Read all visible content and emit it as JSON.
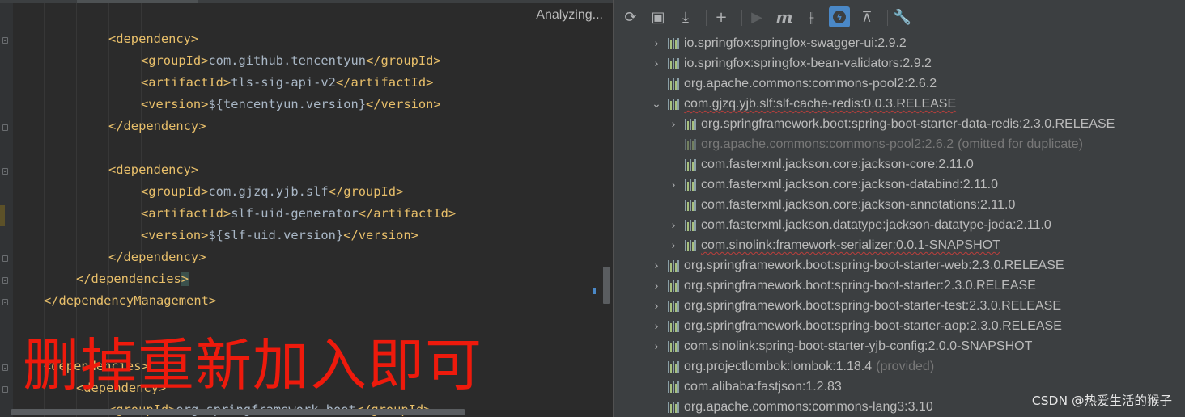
{
  "editor": {
    "status": "Analyzing...",
    "lines": [
      {
        "indent": 3,
        "parts": [
          {
            "t": "tag",
            "v": "<dependency>"
          }
        ]
      },
      {
        "indent": 4,
        "parts": [
          {
            "t": "tag",
            "v": "<groupId>"
          },
          {
            "t": "txt",
            "v": "com.github.tencentyun"
          },
          {
            "t": "tag",
            "v": "</groupId>"
          }
        ]
      },
      {
        "indent": 4,
        "parts": [
          {
            "t": "tag",
            "v": "<artifactId>"
          },
          {
            "t": "txt",
            "v": "tls-sig-api-v2"
          },
          {
            "t": "tag",
            "v": "</artifactId>"
          }
        ]
      },
      {
        "indent": 4,
        "parts": [
          {
            "t": "tag",
            "v": "<version>"
          },
          {
            "t": "txt",
            "v": "${tencentyun.version}"
          },
          {
            "t": "tag",
            "v": "</version>"
          }
        ]
      },
      {
        "indent": 3,
        "parts": [
          {
            "t": "tag",
            "v": "</dependency>"
          }
        ]
      },
      {
        "indent": 0,
        "parts": []
      },
      {
        "indent": 3,
        "parts": [
          {
            "t": "tag",
            "v": "<dependency>"
          }
        ]
      },
      {
        "indent": 4,
        "parts": [
          {
            "t": "tag",
            "v": "<groupId>"
          },
          {
            "t": "txt",
            "v": "com.gjzq.yjb.slf"
          },
          {
            "t": "tag",
            "v": "</groupId>"
          }
        ]
      },
      {
        "indent": 4,
        "parts": [
          {
            "t": "tag",
            "v": "<artifactId>"
          },
          {
            "t": "txt",
            "v": "slf-uid-generator"
          },
          {
            "t": "tag",
            "v": "</artifactId>"
          }
        ]
      },
      {
        "indent": 4,
        "parts": [
          {
            "t": "tag",
            "v": "<version>"
          },
          {
            "t": "txt",
            "v": "${slf-uid.version}"
          },
          {
            "t": "tag",
            "v": "</version>"
          }
        ]
      },
      {
        "indent": 3,
        "parts": [
          {
            "t": "tag",
            "v": "</dependency>"
          }
        ]
      },
      {
        "indent": 2,
        "parts": [
          {
            "t": "tag",
            "v": "</dependencies"
          },
          {
            "t": "tag hl",
            "v": ">"
          }
        ]
      },
      {
        "indent": 1,
        "parts": [
          {
            "t": "tag",
            "v": "</dependencyManagement>"
          }
        ]
      },
      {
        "indent": 0,
        "parts": []
      },
      {
        "indent": 0,
        "parts": []
      },
      {
        "indent": 1,
        "parts": [
          {
            "t": "tag",
            "v": "<dependencies>"
          }
        ]
      },
      {
        "indent": 2,
        "parts": [
          {
            "t": "tag",
            "v": "<dependency>"
          }
        ]
      },
      {
        "indent": 3,
        "parts": [
          {
            "t": "tag",
            "v": "<groupId>"
          },
          {
            "t": "txt",
            "v": "org.springframework.boot"
          },
          {
            "t": "tag",
            "v": "</groupId>"
          }
        ]
      }
    ],
    "annotation": "删掉重新加入即可"
  },
  "maven": {
    "toolbar": [
      {
        "name": "reload-icon",
        "glyph": "⟳",
        "state": "normal"
      },
      {
        "name": "generate-sources-icon",
        "glyph": "▣",
        "state": "normal"
      },
      {
        "name": "download-icon",
        "glyph": "⤓",
        "state": "normal"
      },
      {
        "name": "sep"
      },
      {
        "name": "add-icon",
        "glyph": "+",
        "state": "normal"
      },
      {
        "name": "sep"
      },
      {
        "name": "run-icon",
        "glyph": "▶",
        "state": "disabled"
      },
      {
        "name": "execute-goal-icon",
        "glyph": "m",
        "state": "normal"
      },
      {
        "name": "toggle-offline-icon",
        "glyph": "⫲",
        "state": "normal"
      },
      {
        "name": "skip-tests-icon",
        "glyph": "ϟ",
        "state": "active"
      },
      {
        "name": "collapse-all-icon",
        "glyph": "⊼",
        "state": "normal"
      },
      {
        "name": "sep"
      },
      {
        "name": "settings-wrench-icon",
        "glyph": "🔧",
        "state": "normal"
      }
    ],
    "tree": [
      {
        "level": 0,
        "chevron": "›",
        "label": "io.springfox:springfox-swagger-ui:2.9.2"
      },
      {
        "level": 0,
        "chevron": "›",
        "label": "io.springfox:springfox-bean-validators:2.9.2"
      },
      {
        "level": 0,
        "chevron": "",
        "label": "org.apache.commons:commons-pool2:2.6.2"
      },
      {
        "level": 0,
        "chevron": "⌄",
        "label": "com.gjzq.yjb.slf:slf-cache-redis:0.0.3.RELEASE",
        "squiggle": true
      },
      {
        "level": 1,
        "chevron": "›",
        "label": "org.springframework.boot:spring-boot-starter-data-redis:2.3.0.RELEASE"
      },
      {
        "level": 1,
        "chevron": "",
        "label": "org.apache.commons:commons-pool2:2.6.2",
        "suffix": "(omitted for duplicate)",
        "omitted": true
      },
      {
        "level": 1,
        "chevron": "",
        "label": "com.fasterxml.jackson.core:jackson-core:2.11.0"
      },
      {
        "level": 1,
        "chevron": "›",
        "label": "com.fasterxml.jackson.core:jackson-databind:2.11.0"
      },
      {
        "level": 1,
        "chevron": "",
        "label": "com.fasterxml.jackson.core:jackson-annotations:2.11.0"
      },
      {
        "level": 1,
        "chevron": "›",
        "label": "com.fasterxml.jackson.datatype:jackson-datatype-joda:2.11.0"
      },
      {
        "level": 1,
        "chevron": "›",
        "label": "com.sinolink:framework-serializer:0.0.1-SNAPSHOT",
        "squiggle": true
      },
      {
        "level": 0,
        "chevron": "›",
        "label": "org.springframework.boot:spring-boot-starter-web:2.3.0.RELEASE"
      },
      {
        "level": 0,
        "chevron": "›",
        "label": "org.springframework.boot:spring-boot-starter:2.3.0.RELEASE"
      },
      {
        "level": 0,
        "chevron": "›",
        "label": "org.springframework.boot:spring-boot-starter-test:2.3.0.RELEASE"
      },
      {
        "level": 0,
        "chevron": "›",
        "label": "org.springframework.boot:spring-boot-starter-aop:2.3.0.RELEASE"
      },
      {
        "level": 0,
        "chevron": "›",
        "label": "com.sinolink:spring-boot-starter-yjb-config:2.0.0-SNAPSHOT"
      },
      {
        "level": 0,
        "chevron": "",
        "label": "org.projectlombok:lombok:1.18.4",
        "suffix": "(provided)"
      },
      {
        "level": 0,
        "chevron": "",
        "label": "com.alibaba:fastjson:1.2.83"
      },
      {
        "level": 0,
        "chevron": "",
        "label": "org.apache.commons:commons-lang3:3.10"
      }
    ]
  },
  "watermark": "CSDN @热爱生活的猴子"
}
